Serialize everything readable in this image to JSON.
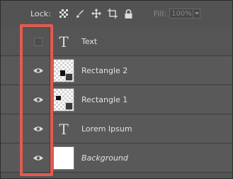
{
  "toolbar": {
    "lock_label": "Lock:",
    "lock_icons": [
      "checkerboard-lock-icon",
      "brush-lock-icon",
      "move-lock-icon",
      "artboard-lock-icon",
      "padlock-icon"
    ],
    "fill_label": "Fill:",
    "fill_value": "100%"
  },
  "layers": [
    {
      "name": "Text",
      "kind": "text",
      "visible": false
    },
    {
      "name": "Rectangle 2",
      "kind": "shape",
      "visible": true
    },
    {
      "name": "Rectangle 1",
      "kind": "shape",
      "visible": true
    },
    {
      "name": "Lorem Ipsum",
      "kind": "text",
      "visible": true
    },
    {
      "name": "Background",
      "kind": "background",
      "visible": true
    }
  ],
  "colors": {
    "panel": "#535353",
    "highlight": "#e35a50"
  }
}
